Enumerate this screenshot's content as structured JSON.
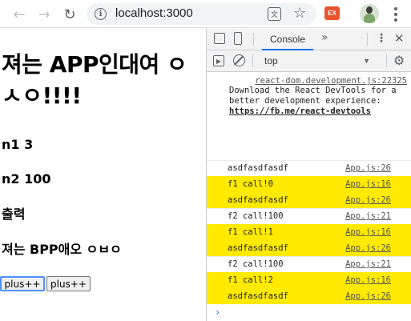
{
  "browser": {
    "url": "localhost:3000",
    "icons": {
      "back": "back-arrow-icon",
      "forward": "forward-arrow-icon",
      "reload": "reload-icon",
      "info": "info-icon",
      "translate": "translate-icon",
      "bookmark": "star-icon",
      "extension": "ex-extension-icon",
      "profile": "profile-avatar",
      "menu": "kebab-menu-icon"
    },
    "extension_label": "EX"
  },
  "page": {
    "heading": "져는 APP인대여 ㅇㅅㅇ!!!!",
    "n1": "n1 3",
    "n2": "n2 100",
    "output_label": "출력",
    "sub_heading": "져는 BPP애오 ㅇㅂㅇ",
    "buttons": [
      "plus++",
      "plus++"
    ]
  },
  "devtools": {
    "active_tab": "Console",
    "more_tabs": "»",
    "context": "top",
    "intro": {
      "source": "react-dom.development.js:22325",
      "text": "Download the React DevTools for a better development experience: ",
      "link": "https://fb.me/react-devtools"
    },
    "logs": [
      {
        "text": "asdfasdfasdf",
        "source": "App.js:26",
        "highlight": false
      },
      {
        "text": "f1 call!0",
        "source": "App.js:16",
        "highlight": true
      },
      {
        "text": "asdfasdfasdf",
        "source": "App.js:26",
        "highlight": true
      },
      {
        "text": "f2 call!100",
        "source": "App.js:21",
        "highlight": false
      },
      {
        "text": "f1 call!1",
        "source": "App.js:16",
        "highlight": true
      },
      {
        "text": "asdfasdfasdf",
        "source": "App.js:26",
        "highlight": true
      },
      {
        "text": "f2 call!100",
        "source": "App.js:21",
        "highlight": false
      },
      {
        "text": "f1 call!2",
        "source": "App.js:16",
        "highlight": true
      },
      {
        "text": "asdfasdfasdf",
        "source": "App.js:26",
        "highlight": true
      }
    ],
    "prompt": "›",
    "highlight_color": "#ffea00"
  }
}
